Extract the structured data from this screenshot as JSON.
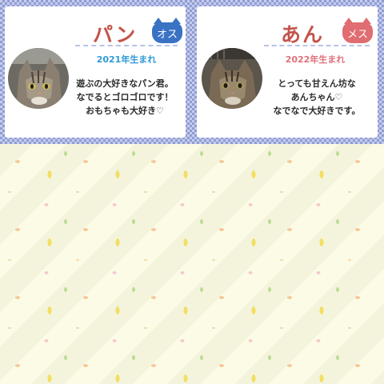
{
  "cats": [
    {
      "name": "パン",
      "sex": "オス",
      "birth": "2021年生まれ",
      "bio_lines": [
        "遊ぶの大好きなパン君。",
        "なでるとゴロゴロです！",
        "おもちゃも大好き♡"
      ],
      "accent": "#2f9ad6",
      "badge_color": "#3a72c4"
    },
    {
      "name": "あん",
      "sex": "メス",
      "birth": "2022年生まれ",
      "bio_lines": [
        "とっても甘えん坊な",
        "あんちゃん♡",
        "なでなで大好きです。"
      ],
      "accent": "#e0707a",
      "badge_color": "#e06d72"
    }
  ]
}
